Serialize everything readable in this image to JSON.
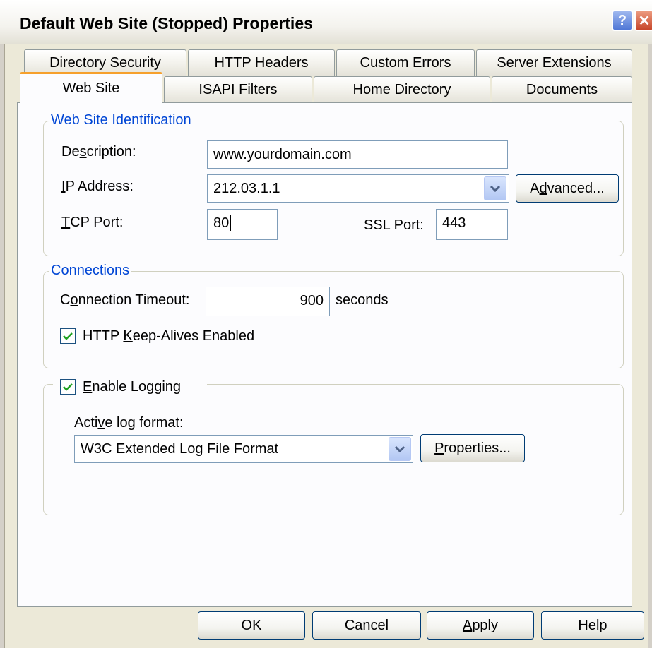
{
  "window": {
    "title": "Default Web Site (Stopped) Properties",
    "help_glyph": "?",
    "close_glyph": "✕"
  },
  "tabs": {
    "row1": [
      "Directory Security",
      "HTTP Headers",
      "Custom Errors",
      "Server Extensions"
    ],
    "row2": [
      "Web Site",
      "ISAPI Filters",
      "Home Directory",
      "Documents"
    ],
    "active": "Web Site"
  },
  "identification": {
    "legend": "Web Site Identification",
    "description_label_pre": "De",
    "description_label_key": "s",
    "description_label_post": "cription:",
    "description_value": "www.yourdomain.com",
    "ip_label_key": "I",
    "ip_label_post": "P Address:",
    "ip_value": "212.03.1.1",
    "advanced_pre": "A",
    "advanced_key": "d",
    "advanced_post": "vanced...",
    "tcp_label_key": "T",
    "tcp_label_post": "CP Port:",
    "tcp_value": "80",
    "ssl_label": "SSL Port:",
    "ssl_value": "443"
  },
  "connections": {
    "legend": "Connections",
    "timeout_label_pre": "C",
    "timeout_label_key": "o",
    "timeout_label_post": "nnection Timeout:",
    "timeout_value": "900",
    "timeout_unit": "seconds",
    "keepalive_pre": "HTTP ",
    "keepalive_key": "K",
    "keepalive_post": "eep-Alives Enabled",
    "keepalive_checked": true
  },
  "logging": {
    "enable_key": "E",
    "enable_post": "nable Logging",
    "enable_checked": true,
    "format_label_pre": "Acti",
    "format_label_key": "v",
    "format_label_post": "e log format:",
    "format_value": "W3C Extended Log File Format",
    "properties_key": "P",
    "properties_post": "roperties..."
  },
  "buttons": {
    "ok": "OK",
    "cancel": "Cancel",
    "apply_key": "A",
    "apply_post": "pply",
    "help": "Help"
  },
  "colors": {
    "accent_tab": "#f6a02c",
    "legend_text": "#0046d5",
    "dialog_bg": "#ece9d8"
  }
}
